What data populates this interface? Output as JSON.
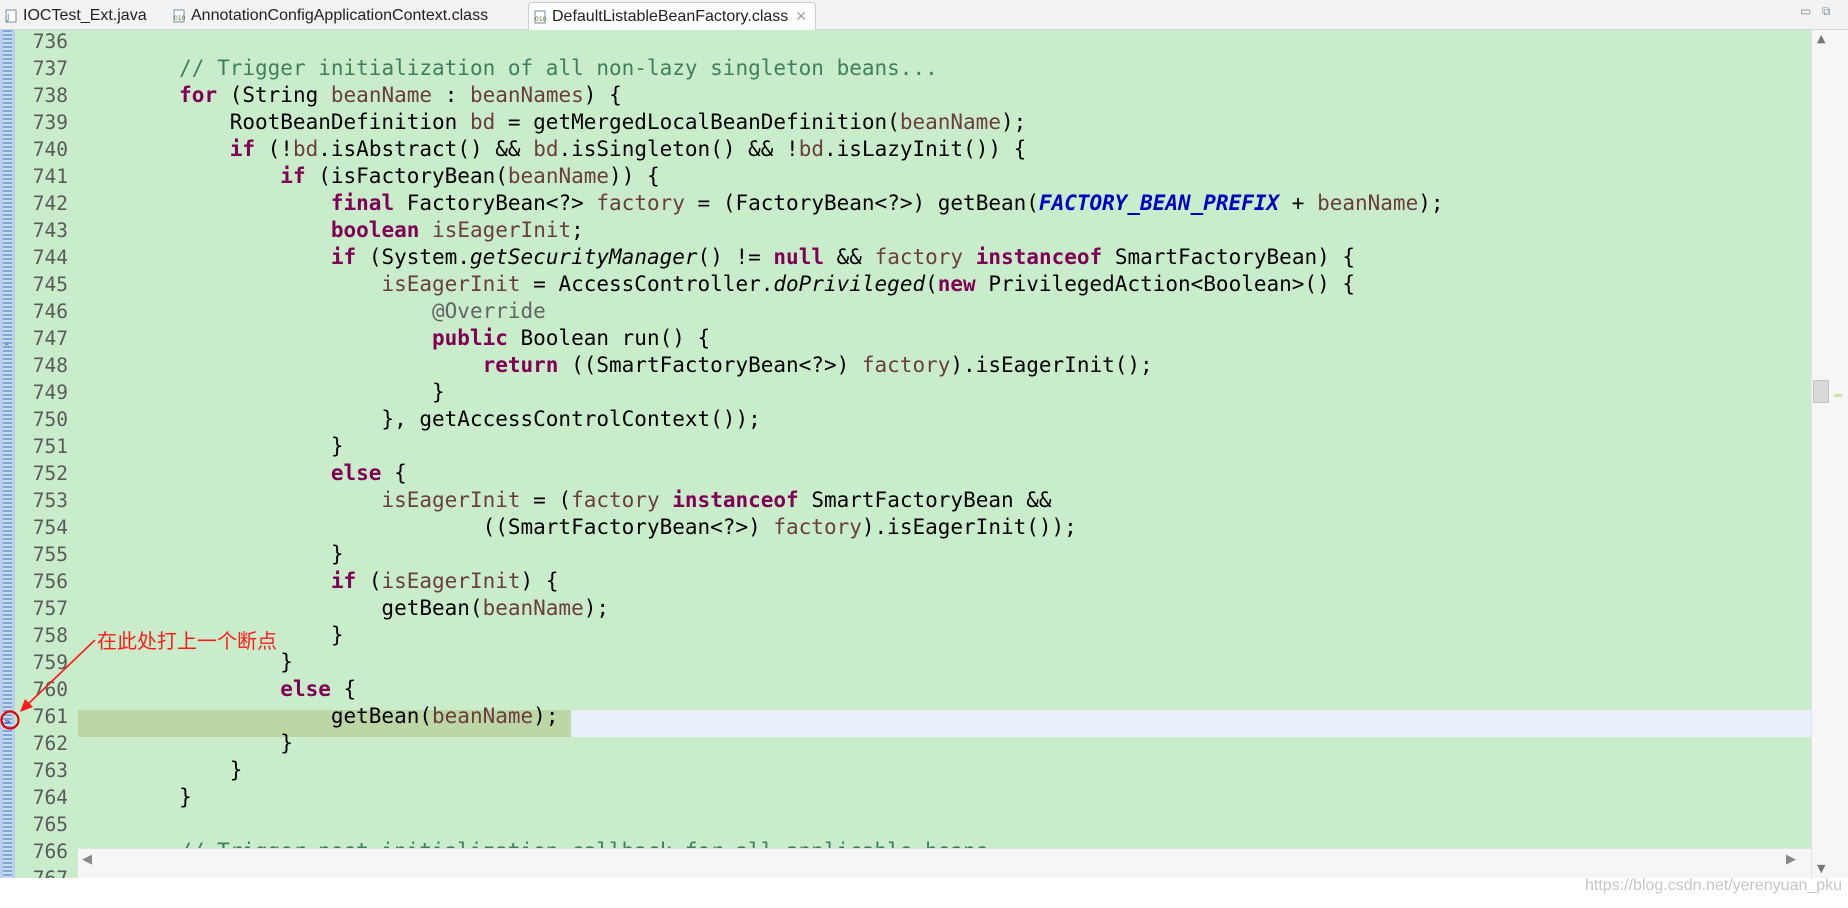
{
  "tabs": [
    {
      "label": "IOCTest_Ext.java",
      "icon": "java-file-icon"
    },
    {
      "label": "AnnotationConfigApplicationContext.class",
      "icon": "class-file-icon"
    },
    {
      "label": "DefaultListableBeanFactory.class",
      "icon": "class-file-icon",
      "active": true
    }
  ],
  "window_controls": {
    "minimize": "▭",
    "restore": "⧉"
  },
  "editor": {
    "current_line": "761",
    "line_numbers": [
      "736",
      "737",
      "738",
      "739",
      "740",
      "741",
      "742",
      "743",
      "744",
      "745",
      "746",
      "747",
      "748",
      "749",
      "750",
      "751",
      "752",
      "753",
      "754",
      "755",
      "756",
      "757",
      "758",
      "759",
      "760",
      "761",
      "762",
      "763",
      "764",
      "765",
      "766",
      "767"
    ]
  },
  "annotation": {
    "text": "在此处打上一个断点",
    "color": "#ff1a1a"
  },
  "watermark": "https://blog.csdn.net/yerenyuan_pku",
  "colors": {
    "code_background": "#c9edcb",
    "current_line": "#e8f1fb",
    "keyword": "#7f0055",
    "comment": "#3f7f5f",
    "local_variable": "#6a3e3e",
    "static_field": "#0000c0",
    "annotation_red": "#ff1a1a"
  }
}
